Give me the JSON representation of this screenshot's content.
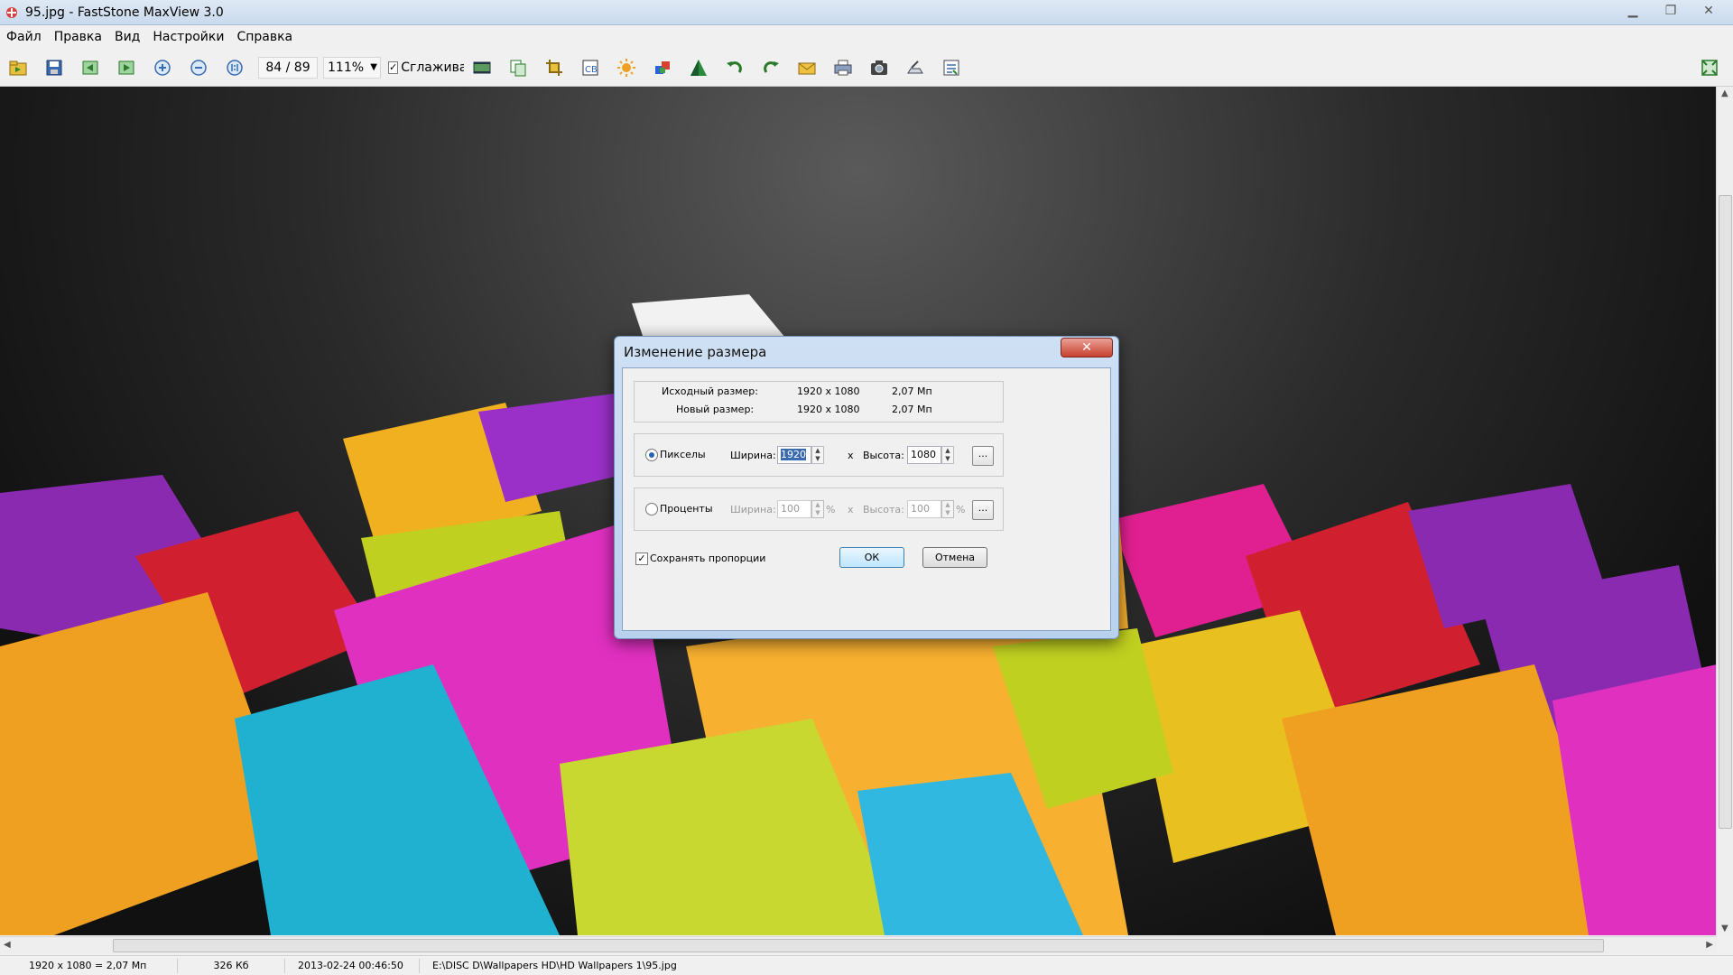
{
  "window": {
    "title": "95.jpg - FastStone MaxView 3.0"
  },
  "menu": [
    "Файл",
    "Правка",
    "Вид",
    "Настройки",
    "Справка"
  ],
  "toolbar": {
    "counter": "84 / 89",
    "zoom": "111%",
    "smoothing_label": "Сглаживание",
    "smoothing_checked": "✓"
  },
  "dialog": {
    "title": "Изменение размера",
    "close": "✕",
    "orig_label": "Исходный размер:",
    "orig_dims": "1920 x 1080",
    "orig_mp": "2,07 Мп",
    "new_label": "Новый размер:",
    "new_dims": "1920 x 1080",
    "new_mp": "2,07 Мп",
    "pixels_label": "Пикселы",
    "width_label": "Ширина:",
    "width_value": "1920",
    "x_sep": "x",
    "height_label": "Высота:",
    "height_value": "1080",
    "dots": "...",
    "percent_label": "Проценты",
    "pwidth_label": "Ширина:",
    "pwidth_value": "100",
    "pct": "%",
    "pheight_label": "Высота:",
    "pheight_value": "100",
    "keep_ratio_label": "Сохранять пропорции",
    "keep_ratio_checked": "✓",
    "ok": "ОК",
    "cancel": "Отмена"
  },
  "status": {
    "dims": "1920 x 1080 = 2,07 Мп",
    "size": "326 Кб",
    "date": "2013-02-24 00:46:50",
    "path": "E:\\DISC D\\Wallpapers HD\\HD Wallpapers 1\\95.jpg"
  }
}
